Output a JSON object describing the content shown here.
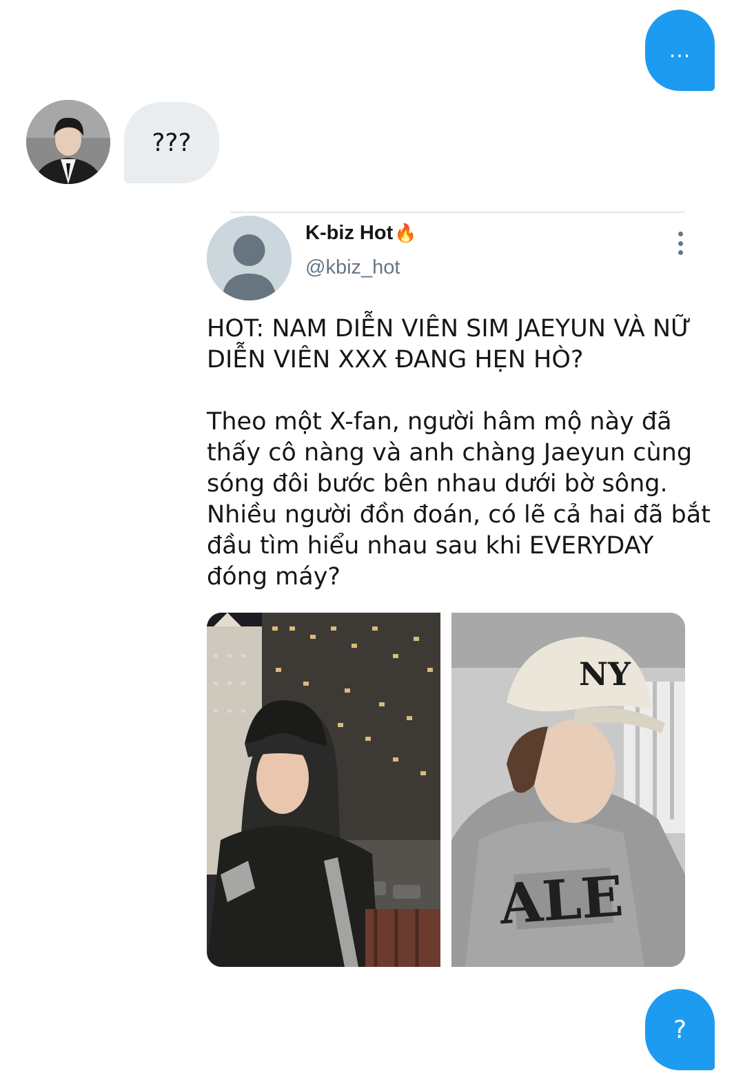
{
  "messages": {
    "outgoing_top": "...",
    "incoming": "???",
    "outgoing_bottom": "?"
  },
  "shared_tweet": {
    "author_name": "K-biz Hot",
    "author_emoji": "🔥",
    "handle": "@kbiz_hot",
    "headline": "HOT: NAM DIỄN VIÊN SIM JAEYUN VÀ NỮ\nDIỄN VIÊN XXX ĐANG HẸN HÒ?",
    "body": "Theo một X-fan, người hâm mộ này đã\nthấy cô nàng và anh chàng Jaeyun cùng\nsóng đôi bước bên nhau dưới bờ sông.\nNhiều người đồn đoán, có lẽ cả hai đã bắt\nđầu tìm hiểu nhau sau khi EVERYDAY\nđóng máy?"
  },
  "colors": {
    "accent": "#1d9bf0",
    "incoming_bubble": "#e9edf0",
    "handle_gray": "#657786"
  }
}
